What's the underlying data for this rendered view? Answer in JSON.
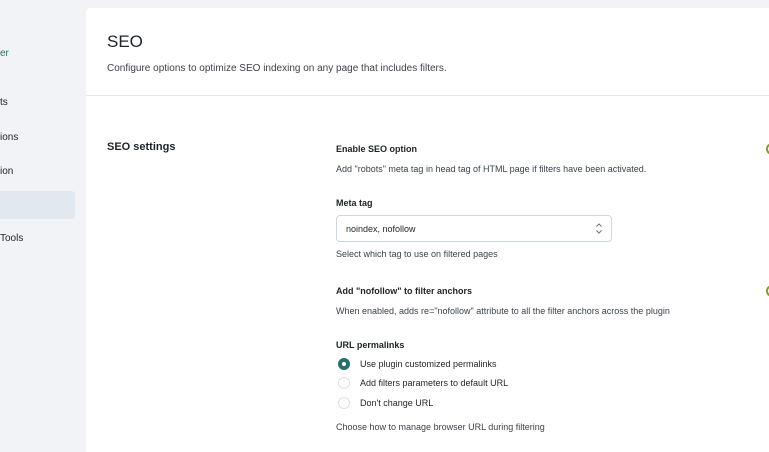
{
  "sidebar": {
    "items": [
      {
        "label": "er",
        "accent": true
      },
      {
        "label": "ts"
      },
      {
        "label": "ions"
      },
      {
        "label": "ion"
      },
      {
        "label": ""
      },
      {
        "label": "Tools"
      }
    ]
  },
  "header": {
    "title": "SEO",
    "description": "Configure options to optimize SEO indexing on any page that includes filters."
  },
  "section": {
    "title": "SEO settings"
  },
  "settings": {
    "enable_seo": {
      "label": "Enable SEO option",
      "hint": "Add \"robots\" meta tag in head tag of HTML page if filters have been activated.",
      "enabled": true
    },
    "meta_tag": {
      "label": "Meta tag",
      "value": "noindex, nofollow",
      "hint": "Select which tag to use on filtered pages"
    },
    "nofollow": {
      "label": "Add \"nofollow\" to filter anchors",
      "hint": "When enabled, adds re=\"nofollow\" attribute to all the filter anchors across the plugin",
      "enabled": true
    },
    "url_permalinks": {
      "label": "URL permalinks",
      "options": [
        {
          "label": "Use plugin customized permalinks",
          "checked": true
        },
        {
          "label": "Add filters parameters to default URL",
          "checked": false
        },
        {
          "label": "Don't change URL",
          "checked": false
        }
      ],
      "hint": "Choose how to manage browser URL during filtering"
    }
  },
  "colors": {
    "accent": "#2a6f6b",
    "toggle_on": "#8c9a2b",
    "background": "#f1f3f6"
  }
}
